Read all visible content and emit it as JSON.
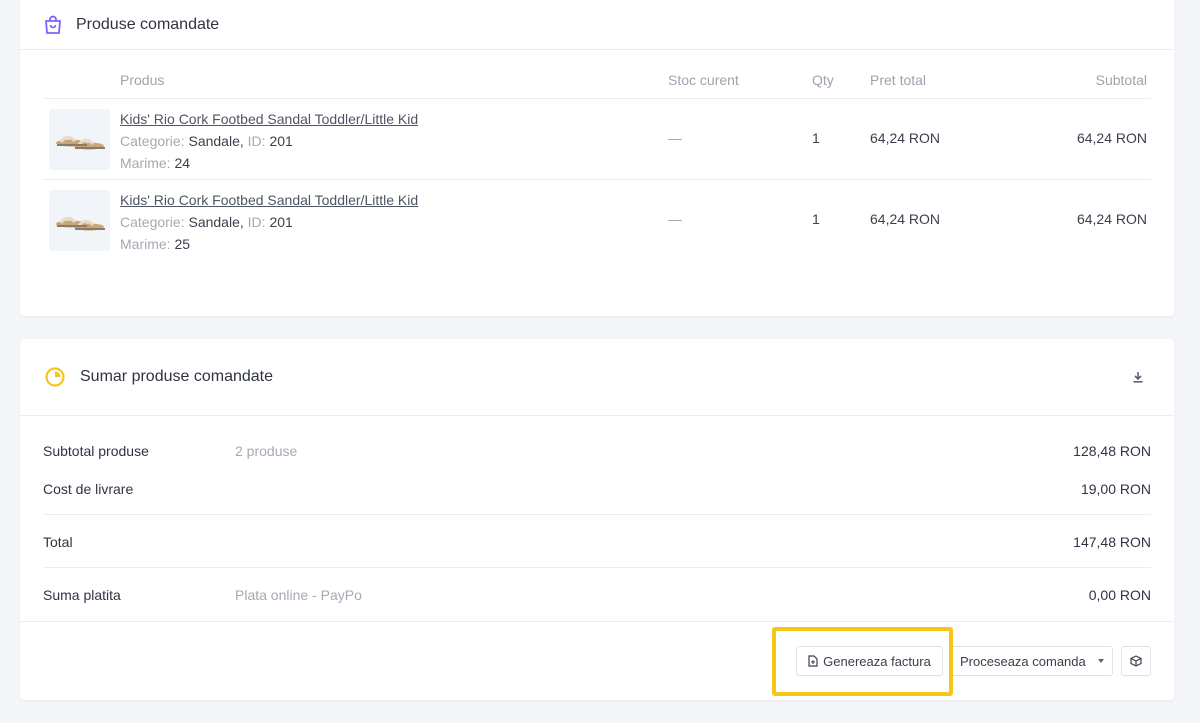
{
  "products_card": {
    "title": "Produse comandate",
    "icon": "shopping-bag-icon",
    "accent": "#7b61ff",
    "columns": {
      "produs": "Produs",
      "stoc": "Stoc curent",
      "qty": "Qty",
      "pret": "Pret total",
      "subtotal": "Subtotal"
    },
    "rows": [
      {
        "name": "Kids' Rio Cork Footbed Sandal Toddler/Little Kid",
        "categorie_label": "Categorie:",
        "categorie_value": "Sandale,",
        "id_label": "ID:",
        "id_value": "201",
        "marime_label": "Marime:",
        "marime_value": "24",
        "stoc": "—",
        "qty": "1",
        "pret": "64,24 RON",
        "subtotal": "64,24 RON"
      },
      {
        "name": "Kids' Rio Cork Footbed Sandal Toddler/Little Kid",
        "categorie_label": "Categorie:",
        "categorie_value": "Sandale,",
        "id_label": "ID:",
        "id_value": "201",
        "marime_label": "Marime:",
        "marime_value": "25",
        "stoc": "—",
        "qty": "1",
        "pret": "64,24 RON",
        "subtotal": "64,24 RON"
      }
    ]
  },
  "summary_card": {
    "title": "Sumar produse comandate",
    "icon": "pie-chart-icon",
    "accent": "#f5c518",
    "download_icon": "download-icon",
    "subtotal_label": "Subtotal produse",
    "subtotal_note": "2 produse",
    "subtotal_value": "128,48 RON",
    "shipping_label": "Cost de livrare",
    "shipping_value": "19,00 RON",
    "total_label": "Total",
    "total_value": "147,48 RON",
    "paid_label": "Suma platita",
    "paid_note": "Plata online - PayPo",
    "paid_value": "0,00 RON",
    "invoice_button": "Genereaza factura",
    "process_select": "Proceseaza comanda",
    "box_icon": "box-icon",
    "highlight_color": "#f5c518"
  }
}
